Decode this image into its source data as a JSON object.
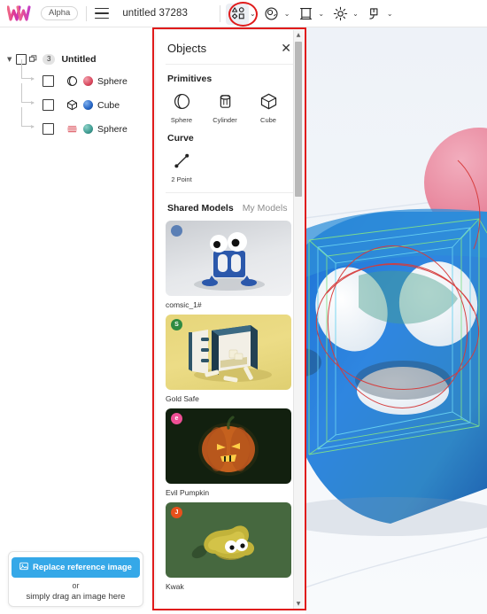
{
  "app": {
    "logo_name": "womp-logo",
    "alpha_label": "Alpha",
    "document_title": "untitled 37283"
  },
  "toolbar": {
    "menu_icon": "hamburger-menu-icon",
    "tools": [
      {
        "icon": "objects-shapes-icon",
        "label": "Objects",
        "active": true,
        "has_chevron": true,
        "highlighted": true
      },
      {
        "icon": "material-sphere-icon",
        "label": "Materials",
        "active": false,
        "has_chevron": true,
        "highlighted": false
      },
      {
        "icon": "scene-frame-icon",
        "label": "Scene",
        "active": false,
        "has_chevron": true,
        "highlighted": false
      },
      {
        "icon": "light-sun-icon",
        "label": "Lighting",
        "active": false,
        "has_chevron": true,
        "highlighted": false
      },
      {
        "icon": "export-icon",
        "label": "Export",
        "active": false,
        "has_chevron": true,
        "highlighted": false
      }
    ],
    "chevron_glyph": "⌄",
    "highlight_color": "#e01b1b"
  },
  "tree": {
    "root": {
      "label": "Untitled",
      "count": "3",
      "expanded": true,
      "checkbox_checked": false,
      "triangle_glyph": "▼",
      "duplicate_icon": "duplicate-group-icon"
    },
    "children": [
      {
        "label": "Sphere",
        "wire_icon": "sphere-wireframe-icon",
        "material_color": "#d8475c",
        "checkbox_checked": false
      },
      {
        "label": "Cube",
        "wire_icon": "cube-wireframe-icon",
        "material_color": "#2565c4",
        "checkbox_checked": false
      },
      {
        "label": "Sphere",
        "wire_icon": "layers-wireframe-icon",
        "material_color": "#3f9c92",
        "checkbox_checked": false
      }
    ]
  },
  "reference_panel": {
    "button_label": "Replace reference image",
    "button_icon": "image-icon",
    "button_color": "#35a8e8",
    "or_label": "or",
    "drag_label": "simply drag an image here"
  },
  "objects_panel": {
    "title": "Objects",
    "close_icon": "close-icon",
    "primitives": {
      "section_label": "Primitives",
      "items": [
        {
          "label": "Sphere",
          "icon": "sphere-icon"
        },
        {
          "label": "Cylinder",
          "icon": "cylinder-icon"
        },
        {
          "label": "Cube",
          "icon": "cube-icon"
        }
      ]
    },
    "curve": {
      "section_label": "Curve",
      "items": [
        {
          "label": "2 Point",
          "icon": "two-point-curve-icon"
        }
      ]
    },
    "tabs": [
      {
        "label": "Shared Models",
        "selected": true
      },
      {
        "label": "My Models",
        "selected": false
      }
    ],
    "models": [
      {
        "label": "comsic_1#",
        "badge_letter": "",
        "badge_color": "#5b7fb5",
        "thumb": "blue-character-thumbnail"
      },
      {
        "label": "Gold Safe",
        "badge_letter": "S",
        "badge_color": "#2f8a42",
        "thumb": "gold-safe-thumbnail"
      },
      {
        "label": "Evil Pumpkin",
        "badge_letter": "e",
        "badge_color": "#ee4f95",
        "thumb": "evil-pumpkin-thumbnail"
      },
      {
        "label": "Kwak",
        "badge_letter": "J",
        "badge_color": "#e8501c",
        "thumb": "kwak-thumbnail"
      }
    ],
    "scrollbar": {
      "up_arrow": "▲",
      "down_arrow": "▼"
    }
  },
  "viewport": {
    "name": "3d-viewport",
    "objects": [
      "blue-perforated-cube",
      "pink-sphere"
    ],
    "selection_wireframe_colors": [
      "#7fe08a",
      "#69d2f0",
      "#d63b3b"
    ]
  }
}
